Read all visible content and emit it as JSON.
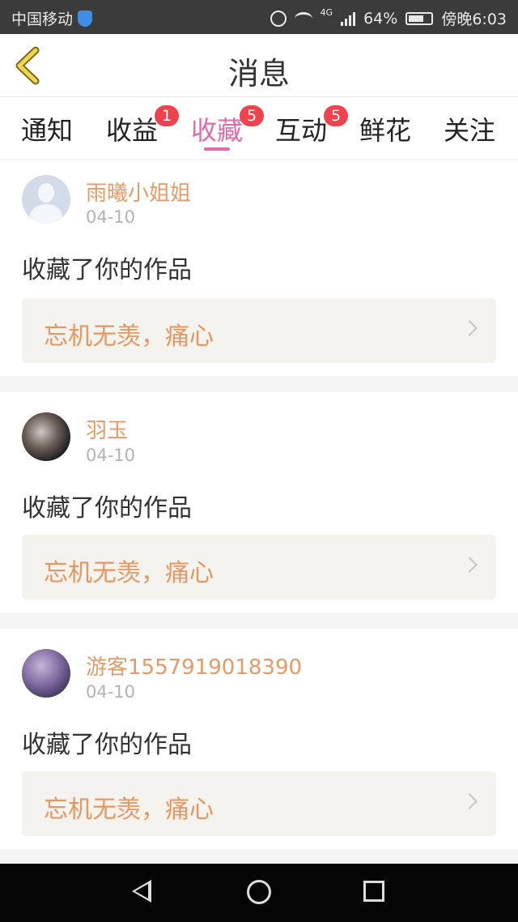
{
  "status_bar": {
    "carrier": "中国移动",
    "network": "4G",
    "battery": "64%",
    "time": "傍晚6:03"
  },
  "header": {
    "title": "消息"
  },
  "tabs": [
    {
      "label": "通知",
      "badge": null
    },
    {
      "label": "收益",
      "badge": "1"
    },
    {
      "label": "收藏",
      "badge": "5",
      "active": true
    },
    {
      "label": "互动",
      "badge": "5"
    },
    {
      "label": "鲜花",
      "badge": null
    },
    {
      "label": "关注",
      "badge": null
    }
  ],
  "messages": [
    {
      "user": "雨曦小姐姐",
      "date": "04-10",
      "action": "收藏了你的作品",
      "work": "忘机无羡，痛心"
    },
    {
      "user": "羽玉",
      "date": "04-10",
      "action": "收藏了你的作品",
      "work": "忘机无羡，痛心"
    },
    {
      "user": "游客1557919018390",
      "date": "04-10",
      "action": "收藏了你的作品",
      "work": "忘机无羡，痛心"
    }
  ],
  "colors": {
    "accent_tab": "#e46aa8",
    "badge": "#f0424c",
    "username": "#e79a66",
    "work_title": "#e89762"
  }
}
